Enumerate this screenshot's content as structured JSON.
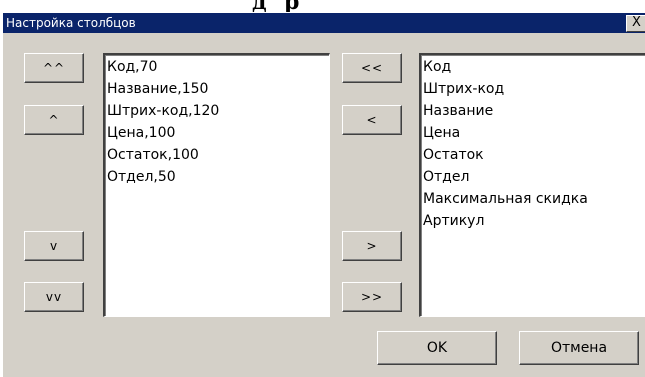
{
  "window": {
    "title": "Настройка столбцов",
    "close_label": "X"
  },
  "move_buttons": {
    "to_top": "^^",
    "up": "^",
    "down": "v",
    "to_bottom": "vv"
  },
  "selected_columns": [
    "Код,70",
    "Название,150",
    "Штрих-код,120",
    "Цена,100",
    "Остаток,100",
    "Отдел,50"
  ],
  "transfer_buttons": {
    "add_all": "<<",
    "add": "<",
    "remove": ">",
    "remove_all": ">>"
  },
  "available_columns": [
    "Код",
    "Штрих-код",
    "Название",
    "Цена",
    "Остаток",
    "Отдел",
    "Максимальная скидка",
    "Артикул"
  ],
  "footer": {
    "ok_label": "OK",
    "cancel_label": "Отмена"
  }
}
